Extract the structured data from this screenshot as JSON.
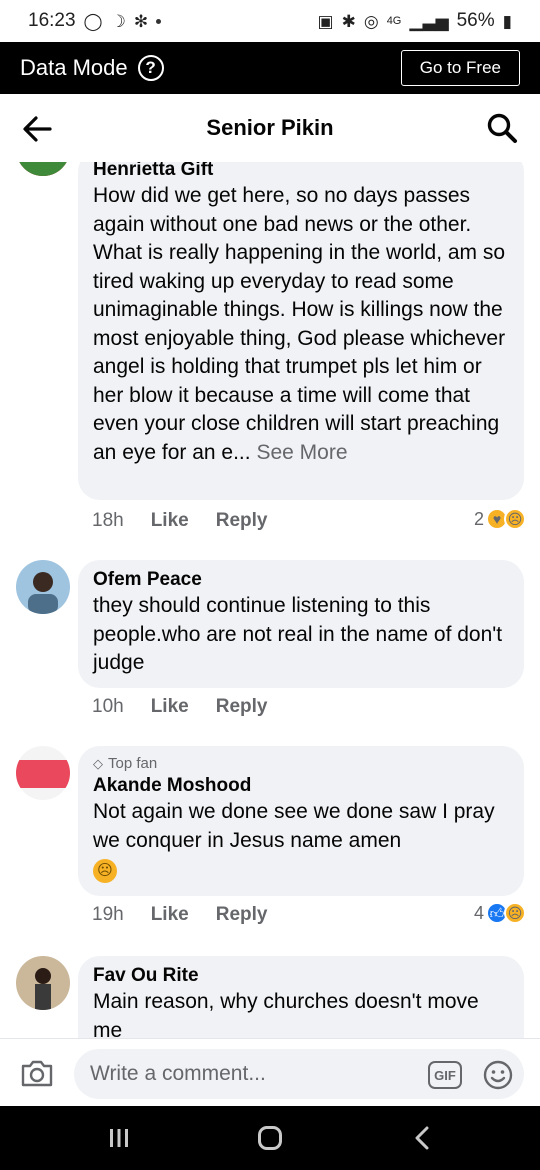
{
  "status_bar": {
    "time": "16:23",
    "network": "4G",
    "battery": "56%"
  },
  "data_mode": {
    "label": "Data Mode",
    "help": "?",
    "go_free": "Go to Free"
  },
  "header": {
    "title": "Senior Pikin"
  },
  "comments": [
    {
      "author": "Henrietta Gift",
      "text": "How did we get here,  so no days passes again without one bad news or the other. What is really happening in the world, am so tired waking up everyday to read some unimaginable things. How is killings now the most enjoyable thing, God please whichever angel is holding that trumpet pls let him or her blow it because a time will come that even your close children will start preaching an eye for an e...",
      "see_more": "See More",
      "time": "18h",
      "like": "Like",
      "reply": "Reply",
      "reaction_count": "2",
      "reactions": [
        "care",
        "sad"
      ]
    },
    {
      "author": "Ofem Peace",
      "text": "they should continue listening to this people.who are not real in the name of don't judge",
      "time": "10h",
      "like": "Like",
      "reply": "Reply"
    },
    {
      "badge": "Top fan",
      "author": "Akande Moshood",
      "text": "Not again we done see we done saw I pray we conquer in Jesus name amen",
      "time": "19h",
      "like": "Like",
      "reply": "Reply",
      "reaction_count": "4",
      "reactions": [
        "like",
        "sad"
      ]
    },
    {
      "author": "Fav Ou Rite",
      "text": "Main reason, why churches doesn't move me"
    }
  ],
  "compose": {
    "placeholder": "Write a comment...",
    "gif": "GIF"
  },
  "colors": {
    "secondary_text": "#65676b",
    "bubble": "#f0f2f5",
    "like_blue": "#1877f2",
    "sad_yellow": "#f7b125"
  }
}
